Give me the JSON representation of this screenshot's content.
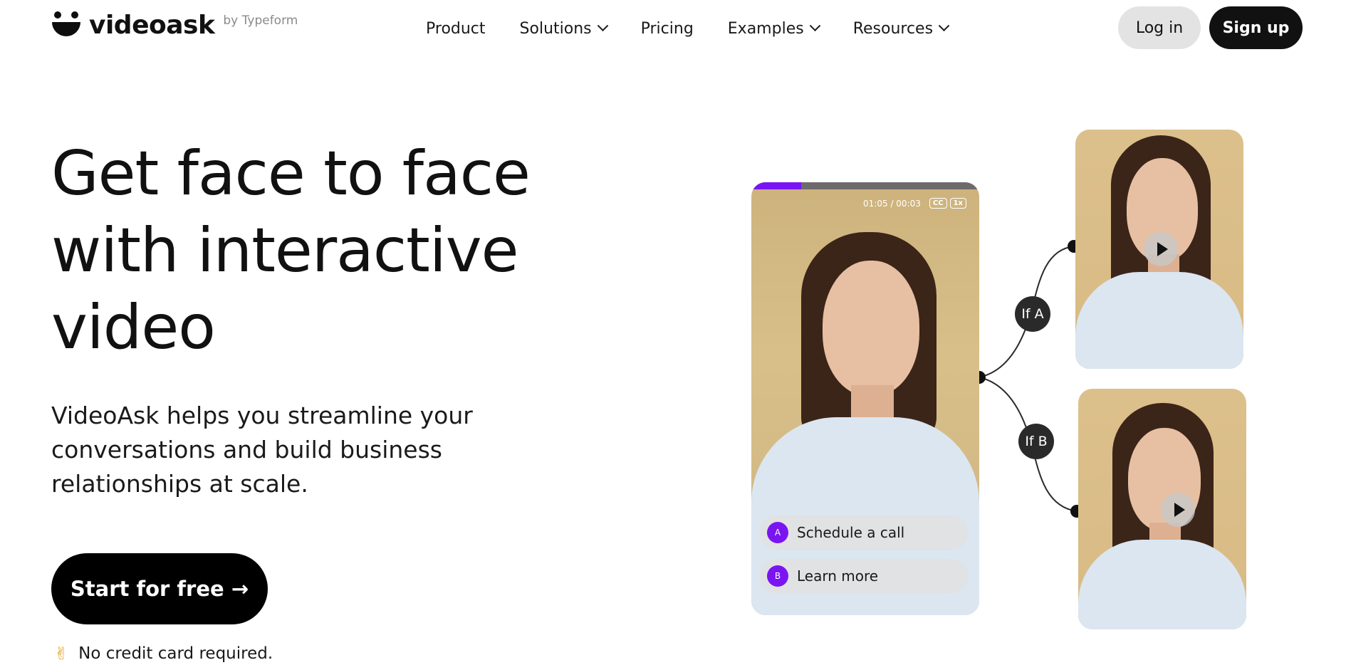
{
  "nav": {
    "logo_text": "videoask",
    "logo_byline": "by Typeform",
    "links": [
      {
        "label": "Product",
        "has_dropdown": false
      },
      {
        "label": "Solutions",
        "has_dropdown": true
      },
      {
        "label": "Pricing",
        "has_dropdown": false
      },
      {
        "label": "Examples",
        "has_dropdown": true
      },
      {
        "label": "Resources",
        "has_dropdown": true
      }
    ],
    "login_label": "Log in",
    "signup_label": "Sign up"
  },
  "hero": {
    "title_line1": "Get face to face",
    "title_line2": "with interactive",
    "title_line3": "video",
    "subtitle_line1": "VideoAsk helps you streamline your",
    "subtitle_line2": "conversations and build business",
    "subtitle_line3": "relationships at scale.",
    "cta_label": "Start for free →",
    "note_icon": "✌",
    "note": "No credit card required."
  },
  "demo": {
    "progress": 0.22,
    "time": "01:05 / 00:03",
    "cc_label": "CC",
    "speed_label": "1x",
    "choices": [
      {
        "key": "A",
        "label": "Schedule a call"
      },
      {
        "key": "B",
        "label": "Learn more"
      }
    ],
    "branches": [
      {
        "label": "If A"
      },
      {
        "label": "If B"
      }
    ]
  },
  "colors": {
    "accent": "#7a15f2",
    "primary_button": "#111111",
    "secondary_button": "#e3e3e3"
  }
}
